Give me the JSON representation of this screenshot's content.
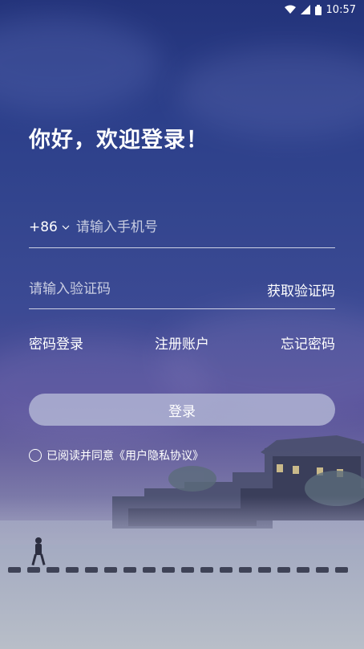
{
  "status_bar": {
    "time": "10:57",
    "icons": [
      "wifi-icon",
      "signal-icon",
      "battery-icon"
    ]
  },
  "greeting": "你好，欢迎登录！",
  "phone": {
    "country_code": "+86",
    "placeholder": "请输入手机号"
  },
  "code": {
    "placeholder": "请输入验证码",
    "get_code_label": "获取验证码"
  },
  "links": {
    "password_login": "密码登录",
    "register": "注册账户",
    "forgot_password": "忘记密码"
  },
  "login_button": "登录",
  "agreement": {
    "text": "已阅读并同意《用户隐私协议》",
    "checked": false
  },
  "colors": {
    "background_top": "#23337a",
    "background_bottom": "#aab3bd",
    "button": "#bec4dc"
  }
}
